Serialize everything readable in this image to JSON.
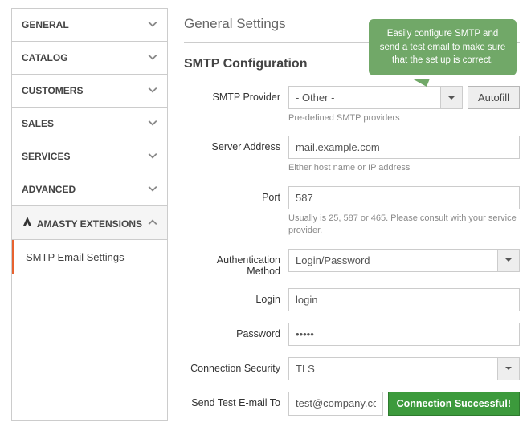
{
  "sidebar": {
    "items": [
      {
        "label": "General",
        "expanded": false
      },
      {
        "label": "Catalog",
        "expanded": false
      },
      {
        "label": "Customers",
        "expanded": false
      },
      {
        "label": "Sales",
        "expanded": false
      },
      {
        "label": "Services",
        "expanded": false
      },
      {
        "label": "Advanced",
        "expanded": false
      },
      {
        "label": "Amasty Extensions",
        "expanded": true
      }
    ],
    "sub_label": "SMTP Email Settings"
  },
  "main": {
    "general_title": "General Settings",
    "smtp_title": "SMTP Configuration"
  },
  "tooltip": {
    "text": "Easily configure SMTP and send a test email to make sure that the set up is correct."
  },
  "fields": {
    "provider": {
      "label": "SMTP Provider",
      "value": "- Other -",
      "help": "Pre-defined SMTP providers",
      "autofill": "Autofill"
    },
    "server": {
      "label": "Server Address",
      "value": "mail.example.com",
      "help": "Either host name or IP address"
    },
    "port": {
      "label": "Port",
      "value": "587",
      "help": "Usually is 25, 587 or 465. Please consult with your service provider."
    },
    "auth": {
      "label": "Authentication Method",
      "value": "Login/Password"
    },
    "login": {
      "label": "Login",
      "value": "login"
    },
    "password": {
      "label": "Password",
      "value": "•••••"
    },
    "security": {
      "label": "Connection Security",
      "value": "TLS"
    },
    "test": {
      "label": "Send Test E-mail To",
      "value": "test@company.com",
      "button": "Connection Successful!"
    }
  }
}
